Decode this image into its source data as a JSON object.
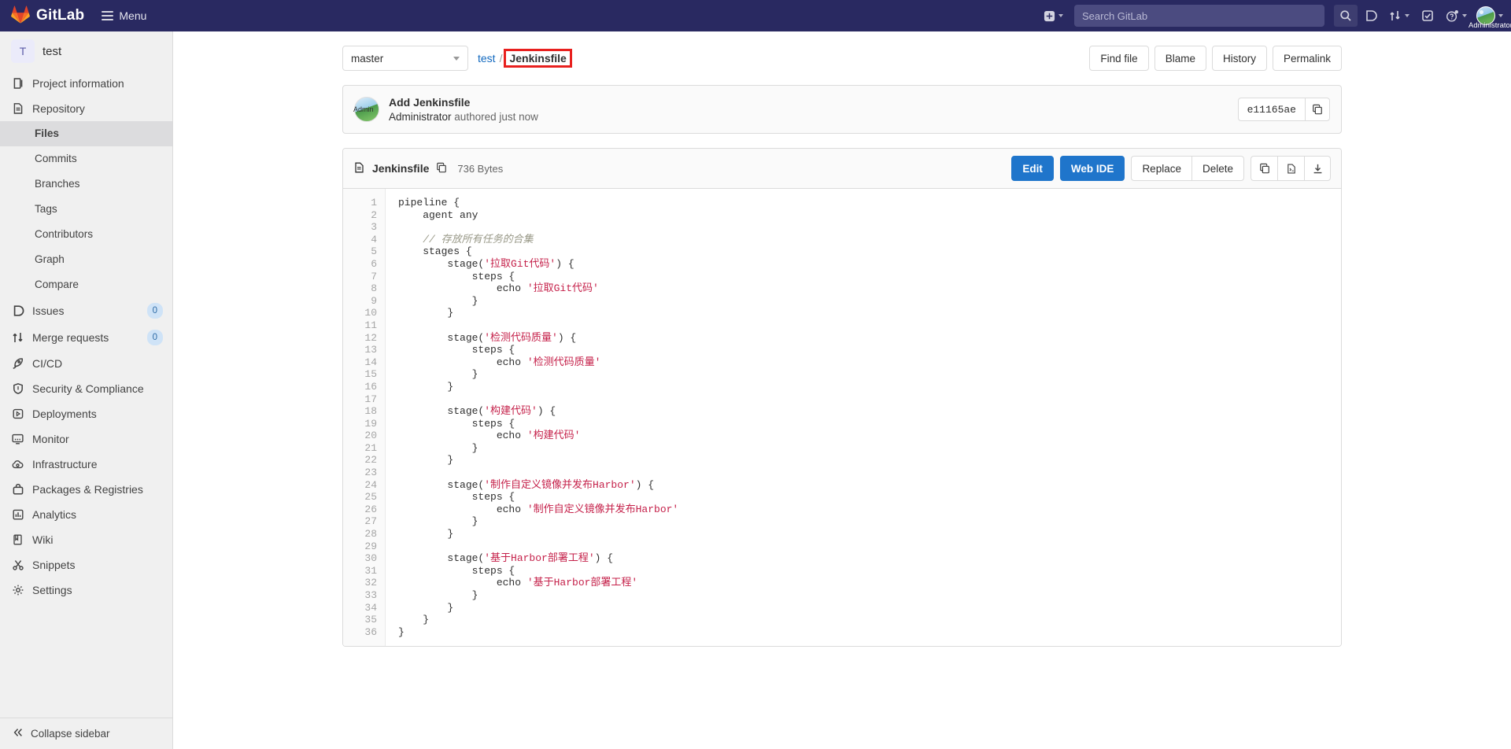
{
  "navbar": {
    "brand": "GitLab",
    "menu_label": "Menu",
    "plus_icon": "plus-square-icon",
    "search_placeholder": "Search GitLab",
    "icons": {
      "search": "search-icon",
      "issues": "issues-icon",
      "merge_requests": "merge-request-icon",
      "todos": "todo-check-icon",
      "help": "help-circle-icon",
      "avatar": "user-avatar-icon"
    },
    "user_name": "Administrator"
  },
  "sidebar": {
    "project_initial": "T",
    "project_name": "test",
    "items": [
      {
        "label": "Project information",
        "icon": "doc-info-icon",
        "type": "top",
        "badge": null
      },
      {
        "label": "Repository",
        "icon": "repository-icon",
        "type": "top",
        "badge": null
      },
      {
        "label": "Files",
        "icon": null,
        "type": "sub",
        "active": true,
        "badge": null
      },
      {
        "label": "Commits",
        "icon": null,
        "type": "sub",
        "active": false,
        "badge": null
      },
      {
        "label": "Branches",
        "icon": null,
        "type": "sub",
        "active": false,
        "badge": null
      },
      {
        "label": "Tags",
        "icon": null,
        "type": "sub",
        "active": false,
        "badge": null
      },
      {
        "label": "Contributors",
        "icon": null,
        "type": "sub",
        "active": false,
        "badge": null
      },
      {
        "label": "Graph",
        "icon": null,
        "type": "sub",
        "active": false,
        "badge": null
      },
      {
        "label": "Compare",
        "icon": null,
        "type": "sub",
        "active": false,
        "badge": null
      },
      {
        "label": "Issues",
        "icon": "issues-icon",
        "type": "top",
        "badge": "0"
      },
      {
        "label": "Merge requests",
        "icon": "merge-request-icon",
        "type": "top",
        "badge": "0"
      },
      {
        "label": "CI/CD",
        "icon": "rocket-icon",
        "type": "top",
        "badge": null
      },
      {
        "label": "Security & Compliance",
        "icon": "shield-icon",
        "type": "top",
        "badge": null
      },
      {
        "label": "Deployments",
        "icon": "deploy-icon",
        "type": "top",
        "badge": null
      },
      {
        "label": "Monitor",
        "icon": "monitor-icon",
        "type": "top",
        "badge": null
      },
      {
        "label": "Infrastructure",
        "icon": "cloud-gear-icon",
        "type": "top",
        "badge": null
      },
      {
        "label": "Packages & Registries",
        "icon": "package-icon",
        "type": "top",
        "badge": null
      },
      {
        "label": "Analytics",
        "icon": "chart-bar-icon",
        "type": "top",
        "badge": null
      },
      {
        "label": "Wiki",
        "icon": "book-icon",
        "type": "top",
        "badge": null
      },
      {
        "label": "Snippets",
        "icon": "scissors-icon",
        "type": "top",
        "badge": null
      },
      {
        "label": "Settings",
        "icon": "gear-icon",
        "type": "top",
        "badge": null
      }
    ],
    "collapse_label": "Collapse sidebar",
    "collapse_icon": "chevron-double-left-icon"
  },
  "toolbar": {
    "ref_value": "master",
    "breadcrumb": {
      "project": "test",
      "separator": "/",
      "current": "Jenkinsfile"
    },
    "buttons": [
      "Find file",
      "Blame",
      "History",
      "Permalink"
    ]
  },
  "commit": {
    "title": "Add Jenkinsfile",
    "author": "Administrator",
    "meta_suffix": "authored just now",
    "avatar_label": "Admin",
    "sha": "e11165ae",
    "copy_icon": "copy-icon"
  },
  "blob": {
    "file_icon": "file-doc-icon",
    "file_name": "Jenkinsfile",
    "copy_path_icon": "copy-icon",
    "file_size": "736 Bytes",
    "actions": {
      "edit": "Edit",
      "web_ide": "Web IDE",
      "replace": "Replace",
      "delete": "Delete"
    },
    "icon_actions": [
      {
        "name": "copy-contents-icon"
      },
      {
        "name": "open-raw-icon"
      },
      {
        "name": "download-icon"
      }
    ]
  },
  "code": {
    "line_numbers": [
      1,
      2,
      3,
      4,
      5,
      6,
      7,
      8,
      9,
      10,
      11,
      12,
      13,
      14,
      15,
      16,
      17,
      18,
      19,
      20,
      21,
      22,
      23,
      24,
      25,
      26,
      27,
      28,
      29,
      30,
      31,
      32,
      33,
      34,
      35,
      36
    ],
    "lines": [
      [
        {
          "t": "pipeline {",
          "c": "plain"
        }
      ],
      [
        {
          "t": "    agent any",
          "c": "plain"
        }
      ],
      [
        {
          "t": "",
          "c": "plain"
        }
      ],
      [
        {
          "t": "    ",
          "c": "plain"
        },
        {
          "t": "// 存放所有任务的合集",
          "c": "comment"
        }
      ],
      [
        {
          "t": "    stages {",
          "c": "plain"
        }
      ],
      [
        {
          "t": "        stage(",
          "c": "plain"
        },
        {
          "t": "'拉取Git代码'",
          "c": "string"
        },
        {
          "t": ") {",
          "c": "plain"
        }
      ],
      [
        {
          "t": "            steps {",
          "c": "plain"
        }
      ],
      [
        {
          "t": "                echo ",
          "c": "plain"
        },
        {
          "t": "'拉取Git代码'",
          "c": "string"
        }
      ],
      [
        {
          "t": "            }",
          "c": "plain"
        }
      ],
      [
        {
          "t": "        }",
          "c": "plain"
        }
      ],
      [
        {
          "t": "",
          "c": "plain"
        }
      ],
      [
        {
          "t": "        stage(",
          "c": "plain"
        },
        {
          "t": "'检测代码质量'",
          "c": "string"
        },
        {
          "t": ") {",
          "c": "plain"
        }
      ],
      [
        {
          "t": "            steps {",
          "c": "plain"
        }
      ],
      [
        {
          "t": "                echo ",
          "c": "plain"
        },
        {
          "t": "'检测代码质量'",
          "c": "string"
        }
      ],
      [
        {
          "t": "            }",
          "c": "plain"
        }
      ],
      [
        {
          "t": "        }",
          "c": "plain"
        }
      ],
      [
        {
          "t": "",
          "c": "plain"
        }
      ],
      [
        {
          "t": "        stage(",
          "c": "plain"
        },
        {
          "t": "'构建代码'",
          "c": "string"
        },
        {
          "t": ") {",
          "c": "plain"
        }
      ],
      [
        {
          "t": "            steps {",
          "c": "plain"
        }
      ],
      [
        {
          "t": "                echo ",
          "c": "plain"
        },
        {
          "t": "'构建代码'",
          "c": "string"
        }
      ],
      [
        {
          "t": "            }",
          "c": "plain"
        }
      ],
      [
        {
          "t": "        }",
          "c": "plain"
        }
      ],
      [
        {
          "t": "",
          "c": "plain"
        }
      ],
      [
        {
          "t": "        stage(",
          "c": "plain"
        },
        {
          "t": "'制作自定义镜像并发布Harbor'",
          "c": "string"
        },
        {
          "t": ") {",
          "c": "plain"
        }
      ],
      [
        {
          "t": "            steps {",
          "c": "plain"
        }
      ],
      [
        {
          "t": "                echo ",
          "c": "plain"
        },
        {
          "t": "'制作自定义镜像并发布Harbor'",
          "c": "string"
        }
      ],
      [
        {
          "t": "            }",
          "c": "plain"
        }
      ],
      [
        {
          "t": "        }",
          "c": "plain"
        }
      ],
      [
        {
          "t": "",
          "c": "plain"
        }
      ],
      [
        {
          "t": "        stage(",
          "c": "plain"
        },
        {
          "t": "'基于Harbor部署工程'",
          "c": "string"
        },
        {
          "t": ") {",
          "c": "plain"
        }
      ],
      [
        {
          "t": "            steps {",
          "c": "plain"
        }
      ],
      [
        {
          "t": "                echo ",
          "c": "plain"
        },
        {
          "t": "'基于Harbor部署工程'",
          "c": "string"
        }
      ],
      [
        {
          "t": "            }",
          "c": "plain"
        }
      ],
      [
        {
          "t": "        }",
          "c": "plain"
        }
      ],
      [
        {
          "t": "    }",
          "c": "plain"
        }
      ],
      [
        {
          "t": "}",
          "c": "plain"
        }
      ]
    ]
  },
  "colors": {
    "navbar_bg": "#292961",
    "primary_btn": "#1f75cb",
    "link": "#1068bf",
    "highlight_outline": "#e8201e",
    "string_token": "#c5214a",
    "comment_token": "#998877"
  }
}
